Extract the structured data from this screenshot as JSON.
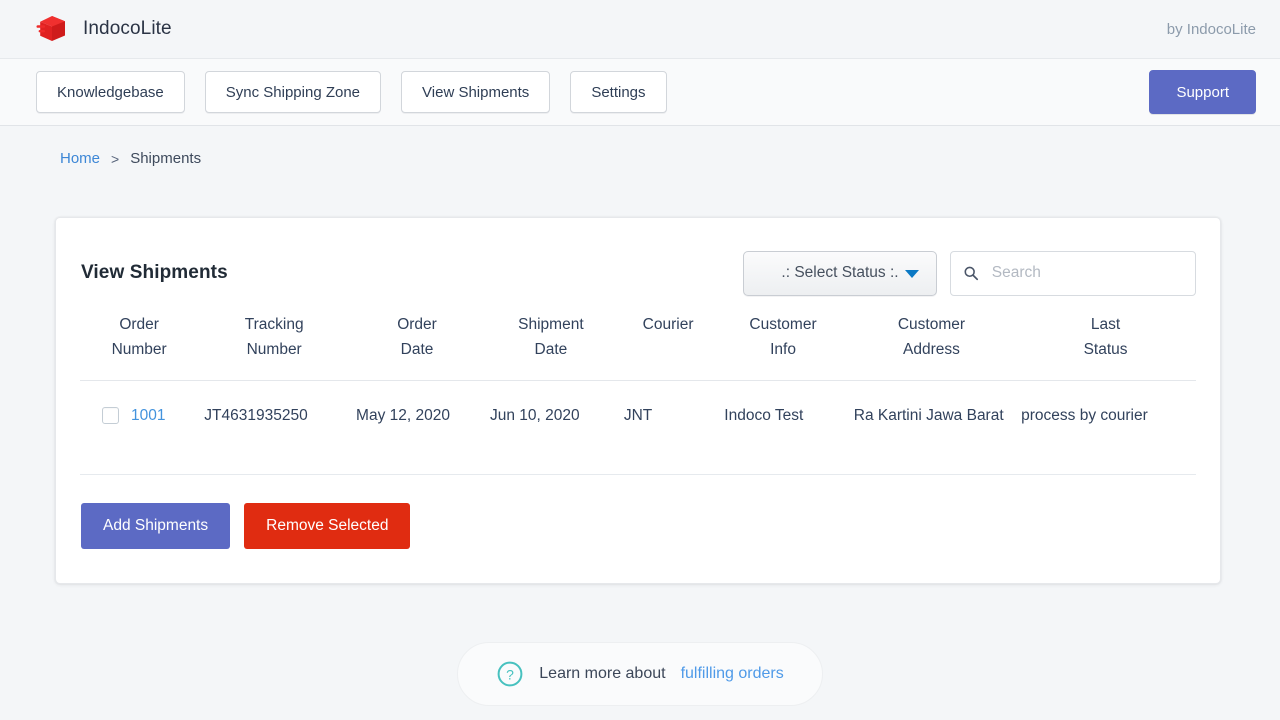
{
  "header": {
    "brand_name": "IndocoLite",
    "logo_icon": "red-box-cube-icon",
    "byline": "by IndocoLite"
  },
  "nav": {
    "buttons": [
      {
        "label": "Knowledgebase"
      },
      {
        "label": "Sync Shipping Zone"
      },
      {
        "label": "View Shipments"
      },
      {
        "label": "Settings"
      }
    ],
    "support_label": "Support",
    "support_color": "#5c6ac4"
  },
  "breadcrumb": {
    "home": "Home",
    "separator": ">",
    "current": "Shipments"
  },
  "card": {
    "title": "View Shipments",
    "status_filter": {
      "selected": ".: Select Status :.",
      "caret_icon": "chevron-down-icon",
      "caret_color": "#0b79c4"
    },
    "search": {
      "value": "",
      "placeholder": "Search",
      "icon": "search-icon"
    },
    "table": {
      "columns": [
        "Order Number",
        "Tracking Number",
        "Order Date",
        "Shipment Date",
        "Courier",
        "Customer Info",
        "Customer Address",
        "Last Status"
      ],
      "columns_split": [
        {
          "line1": "Order",
          "line2": "Number"
        },
        {
          "line1": "Tracking",
          "line2": "Number"
        },
        {
          "line1": "Order",
          "line2": "Date"
        },
        {
          "line1": "Shipment",
          "line2": "Date"
        },
        {
          "line1": "Courier",
          "line2": ""
        },
        {
          "line1": "Customer",
          "line2": "Info"
        },
        {
          "line1": "Customer",
          "line2": "Address"
        },
        {
          "line1": "Last",
          "line2": "Status"
        }
      ],
      "rows": [
        {
          "selected": false,
          "order_number": "1001",
          "tracking_number": "JT4631935250",
          "order_date": "May 12, 2020",
          "shipment_date": "Jun 10, 2020",
          "courier": "JNT",
          "customer_info": "Indoco Test",
          "customer_address": "Ra Kartini Jawa Barat",
          "last_status": "process by courier"
        }
      ]
    },
    "actions": {
      "add_label": "Add Shipments",
      "add_color": "#5c6ac4",
      "remove_label": "Remove Selected",
      "remove_color": "#e02c11"
    }
  },
  "footer": {
    "icon": "question-circle-icon",
    "icon_color": "#47c1bf",
    "text": "Learn more about",
    "link_label": "fulfilling orders"
  }
}
